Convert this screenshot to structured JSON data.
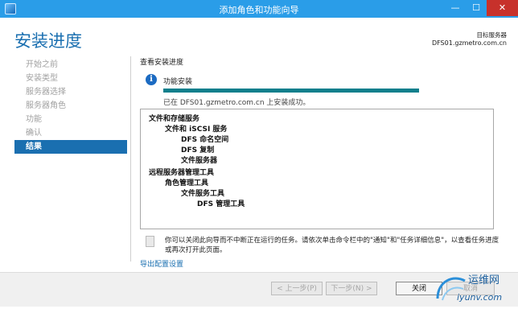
{
  "window": {
    "title": "添加角色和功能向导",
    "minimize": "—",
    "maximize": "☐",
    "close": "✕"
  },
  "header": {
    "page_title": "安装进度",
    "destination_label": "目标服务器",
    "destination_server": "DFS01.gzmetro.com.cn"
  },
  "nav": {
    "items": [
      {
        "label": "开始之前",
        "active": false
      },
      {
        "label": "安装类型",
        "active": false
      },
      {
        "label": "服务器选择",
        "active": false
      },
      {
        "label": "服务器角色",
        "active": false
      },
      {
        "label": "功能",
        "active": false
      },
      {
        "label": "确认",
        "active": false
      },
      {
        "label": "结果",
        "active": true
      }
    ]
  },
  "progress": {
    "section_title": "查看安装进度",
    "status_label": "功能安装",
    "fill_fraction": 1.0,
    "status_text": "已在 DFS01.gzmetro.com.cn 上安装成功。"
  },
  "results": {
    "items": [
      {
        "text": "文件和存储服务"
      },
      {
        "text": "文件和 iSCSI 服务"
      },
      {
        "text": "DFS 命名空间"
      },
      {
        "text": "DFS 复制"
      },
      {
        "text": "文件服务器"
      },
      {
        "text": "远程服务器管理工具"
      },
      {
        "text": "角色管理工具"
      },
      {
        "text": "文件服务工具"
      },
      {
        "text": "DFS 管理工具"
      }
    ]
  },
  "note": "你可以关闭此向导而不中断正在运行的任务。请依次单击命令栏中的\"通知\"和\"任务详细信息\"，以查看任务进度或再次打开此页面。",
  "export_link": "导出配置设置",
  "buttons": {
    "previous": "< 上一步(P)",
    "next": "下一步(N) >",
    "close": "关闭",
    "cancel": "取消"
  },
  "watermark": {
    "text": "运维网",
    "url_text": "iyunv.com"
  },
  "colors": {
    "accent": "#1a6fb0",
    "titlebar": "#2a9de8",
    "progress": "#0e7f8c",
    "close_button": "#c7312b"
  }
}
